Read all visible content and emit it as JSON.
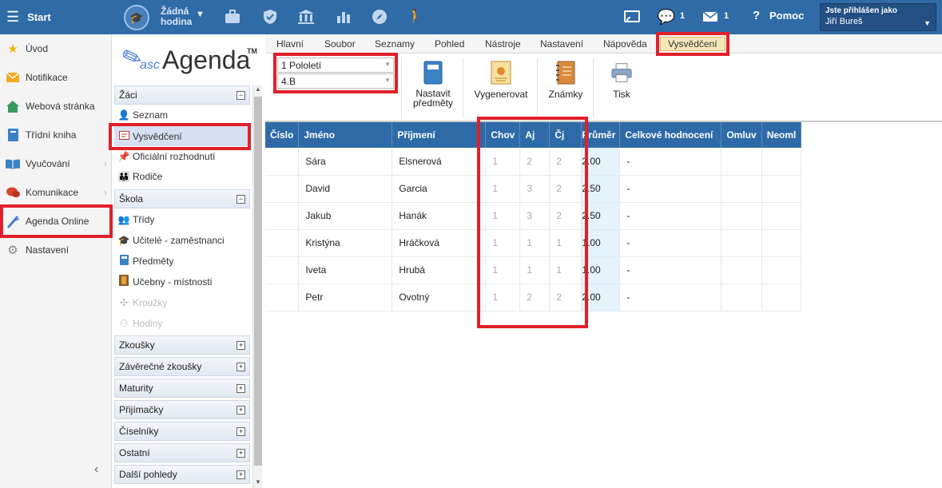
{
  "topbar": {
    "start_label": "Start",
    "hour_line1": "Žádná",
    "hour_line2": "hodina",
    "chat_count": "1",
    "mail_count": "1",
    "help_label": "Pomoc",
    "user_line1": "Jste přihlášen jako",
    "user_line2": "Jiří Bureš"
  },
  "leftnav": {
    "items": [
      {
        "label": "Úvod",
        "icon": "star-icon"
      },
      {
        "label": "Notifikace",
        "icon": "envelope-icon"
      },
      {
        "label": "Webová stránka",
        "icon": "house-icon"
      },
      {
        "label": "Třídní kniha",
        "icon": "book-icon"
      },
      {
        "label": "Vyučování",
        "icon": "open-book-icon"
      },
      {
        "label": "Komunikace",
        "icon": "chat-icon"
      },
      {
        "label": "Agenda Online",
        "icon": "pen-icon"
      },
      {
        "label": "Nastavení",
        "icon": "gear-icon"
      }
    ]
  },
  "logo": {
    "asc": "asc",
    "agenda": "Agenda",
    "tm": "TM"
  },
  "tree": {
    "sec_zaci": "Žáci",
    "zaci_items": [
      "Seznam",
      "Vysvědčení",
      "Oficiální rozhodnutí",
      "Rodiče"
    ],
    "sec_skola": "Škola",
    "skola_items": [
      "Třídy",
      "Učitelé - zaměstnanci",
      "Předměty",
      "Učebny - místnosti",
      "Kroužky",
      "Hodiny"
    ],
    "collapsed": [
      "Zkoušky",
      "Závěrečné zkoušky",
      "Maturity",
      "Přijímačky",
      "Číselníky",
      "Ostatní",
      "Další pohledy"
    ]
  },
  "menu": [
    "Hlavní",
    "Soubor",
    "Seznamy",
    "Pohled",
    "Nástroje",
    "Nastavení",
    "Nápověda",
    "Vysvědčení"
  ],
  "ribbon": {
    "period": "1 Pololetí",
    "class": "4.B",
    "btn_subjects_1": "Nastavit",
    "btn_subjects_2": "předměty",
    "btn_generate": "Vygenerovat",
    "btn_grades": "Známky",
    "btn_print": "Tisk"
  },
  "table": {
    "headers": [
      "Číslo",
      "Jméno",
      "Příjmení",
      "Chov",
      "Aj",
      "Čj",
      "Průměr",
      "Celkové hodnocení",
      "Omluv",
      "Neoml"
    ],
    "rows": [
      [
        "",
        "Sára",
        "Elsnerová",
        "1",
        "2",
        "2",
        "2.00",
        "-",
        "",
        ""
      ],
      [
        "",
        "David",
        "Garcia",
        "1",
        "3",
        "2",
        "2.50",
        "-",
        "",
        ""
      ],
      [
        "",
        "Jakub",
        "Hanák",
        "1",
        "3",
        "2",
        "2.50",
        "-",
        "",
        ""
      ],
      [
        "",
        "Kristýna",
        "Hráčková",
        "1",
        "1",
        "1",
        "1.00",
        "-",
        "",
        ""
      ],
      [
        "",
        "Iveta",
        "Hrubá",
        "1",
        "1",
        "1",
        "1.00",
        "-",
        "",
        ""
      ],
      [
        "",
        "Petr",
        "Ovotný",
        "1",
        "2",
        "2",
        "2.00",
        "-",
        "",
        ""
      ]
    ]
  },
  "colors": {
    "header_blue": "#2e6aa8",
    "topbar_blue": "#2f6ba7",
    "highlight_red": "#e0202a",
    "avg_bg": "#e5f3fb"
  }
}
